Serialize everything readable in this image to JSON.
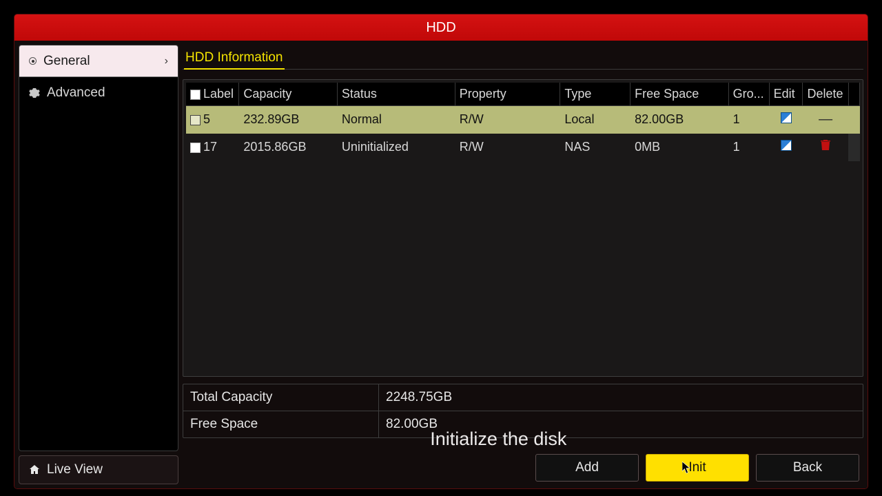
{
  "title": "HDD",
  "sidebar": {
    "items": [
      {
        "label": "General",
        "active": true
      },
      {
        "label": "Advanced",
        "active": false
      }
    ],
    "liveview_label": "Live View"
  },
  "tab": {
    "label": "HDD Information"
  },
  "table": {
    "headers": {
      "label": "Label",
      "capacity": "Capacity",
      "status": "Status",
      "property": "Property",
      "type": "Type",
      "free": "Free Space",
      "group": "Gro...",
      "edit": "Edit",
      "delete": "Delete"
    },
    "rows": [
      {
        "label": "5",
        "capacity": "232.89GB",
        "status": "Normal",
        "property": "R/W",
        "type": "Local",
        "free": "82.00GB",
        "group": "1",
        "selected": true,
        "deletable": false
      },
      {
        "label": "17",
        "capacity": "2015.86GB",
        "status": "Uninitialized",
        "property": "R/W",
        "type": "NAS",
        "free": "0MB",
        "group": "1",
        "selected": false,
        "deletable": true
      }
    ]
  },
  "summary": {
    "total_label": "Total Capacity",
    "total_value": "2248.75GB",
    "free_label": "Free Space",
    "free_value": "82.00GB"
  },
  "hint": "Initialize the disk",
  "buttons": {
    "add": "Add",
    "init": "Init",
    "back": "Back"
  }
}
